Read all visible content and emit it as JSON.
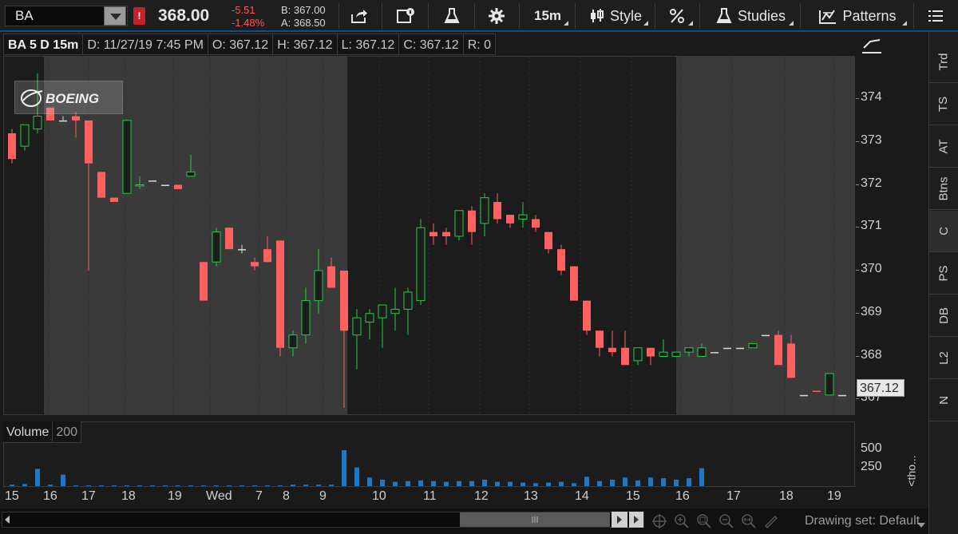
{
  "toolbar": {
    "symbol": "BA",
    "alert_badge": "!",
    "last_price": "368.00",
    "net_change": "-5.51",
    "percent_change": "-1.48%",
    "bid": "B: 367.00",
    "ask": "A: 368.50",
    "interval_label": "15m",
    "style_label": "Style",
    "studies_label": "Studies",
    "patterns_label": "Patterns"
  },
  "chart_header": {
    "title": "BA 5 D 15m",
    "date": "D: 11/27/19 7:45 PM",
    "open": "O: 367.12",
    "high": "H: 367.12",
    "low": "L: 367.12",
    "close": "C: 367.12",
    "range": "R: 0"
  },
  "volume_header": {
    "label": "Volume",
    "value": "200"
  },
  "price_axis_labels": [
    "374",
    "373",
    "372",
    "371",
    "370",
    "369",
    "368",
    "367"
  ],
  "current_price_tag": "367.12",
  "volume_axis_labels": [
    "500",
    "250"
  ],
  "volume_axis_unit": "<tho...",
  "time_axis_labels": [
    "15",
    "16",
    "17",
    "18",
    "19",
    "Wed",
    "7",
    "8",
    "9",
    "10",
    "11",
    "12",
    "13",
    "14",
    "15",
    "16",
    "17",
    "18",
    "19"
  ],
  "sidebar_tabs": [
    "Trd",
    "TS",
    "AT",
    "Btns",
    "C",
    "PS",
    "DB",
    "L2",
    "N"
  ],
  "sidebar_active": "C",
  "drawing_set_label": "Drawing set: Default",
  "logo_text": "BOEING",
  "colors": {
    "up": "#22cc44",
    "down": "#ff6060",
    "volume": "#1e78c8",
    "accent": "#0a4f86"
  },
  "chart_data": {
    "type": "candlestick",
    "symbol": "BA",
    "aggregation": "15m",
    "span": "5 D",
    "ylim": [
      366.8,
      374.8
    ],
    "candles": [
      {
        "o": 372.6,
        "h": 373.3,
        "l": 372.5,
        "c": 373.2,
        "dir": "down"
      },
      {
        "o": 372.9,
        "h": 373.4,
        "l": 372.8,
        "c": 373.4,
        "dir": "up"
      },
      {
        "o": 373.3,
        "h": 374.6,
        "l": 373.2,
        "c": 373.6,
        "dir": "up"
      },
      {
        "o": 373.8,
        "h": 373.8,
        "l": 373.5,
        "c": 373.5,
        "dir": "down"
      },
      {
        "o": 373.5,
        "h": 373.6,
        "l": 373.5,
        "c": 373.5,
        "dir": "flat"
      },
      {
        "o": 373.6,
        "h": 373.7,
        "l": 373.1,
        "c": 373.5,
        "dir": "down"
      },
      {
        "o": 373.5,
        "h": 373.5,
        "l": 370.0,
        "c": 372.5,
        "dir": "down"
      },
      {
        "o": 372.3,
        "h": 372.3,
        "l": 371.7,
        "c": 371.7,
        "dir": "down"
      },
      {
        "o": 371.7,
        "h": 371.7,
        "l": 371.6,
        "c": 371.6,
        "dir": "down"
      },
      {
        "o": 371.8,
        "h": 373.5,
        "l": 371.8,
        "c": 373.5,
        "dir": "up"
      },
      {
        "o": 372.0,
        "h": 372.2,
        "l": 371.9,
        "c": 372.0,
        "dir": "up"
      },
      {
        "o": 372.1,
        "h": 372.1,
        "l": 372.1,
        "c": 372.1,
        "dir": "flat"
      },
      {
        "o": 372.0,
        "h": 372.0,
        "l": 372.0,
        "c": 372.0,
        "dir": "flat"
      },
      {
        "o": 372.0,
        "h": 372.0,
        "l": 371.9,
        "c": 371.9,
        "dir": "down"
      },
      {
        "o": 372.2,
        "h": 372.7,
        "l": 372.2,
        "c": 372.3,
        "dir": "up"
      },
      {
        "o": 370.2,
        "h": 370.2,
        "l": 369.3,
        "c": 369.3,
        "dir": "down"
      },
      {
        "o": 370.2,
        "h": 371.0,
        "l": 370.1,
        "c": 370.9,
        "dir": "up"
      },
      {
        "o": 371.0,
        "h": 371.0,
        "l": 370.5,
        "c": 370.5,
        "dir": "down"
      },
      {
        "o": 370.5,
        "h": 370.6,
        "l": 370.4,
        "c": 370.5,
        "dir": "flat"
      },
      {
        "o": 370.2,
        "h": 370.3,
        "l": 370.0,
        "c": 370.1,
        "dir": "down"
      },
      {
        "o": 370.5,
        "h": 370.8,
        "l": 370.2,
        "c": 370.2,
        "dir": "down"
      },
      {
        "o": 370.7,
        "h": 370.7,
        "l": 368.0,
        "c": 368.2,
        "dir": "down"
      },
      {
        "o": 368.2,
        "h": 368.6,
        "l": 368.0,
        "c": 368.5,
        "dir": "up"
      },
      {
        "o": 368.5,
        "h": 369.6,
        "l": 368.3,
        "c": 369.3,
        "dir": "up"
      },
      {
        "o": 369.3,
        "h": 370.5,
        "l": 369.0,
        "c": 370.0,
        "dir": "up"
      },
      {
        "o": 370.1,
        "h": 370.3,
        "l": 369.6,
        "c": 369.6,
        "dir": "down"
      },
      {
        "o": 370.0,
        "h": 370.0,
        "l": 366.8,
        "c": 368.6,
        "dir": "down"
      },
      {
        "o": 368.5,
        "h": 369.1,
        "l": 367.7,
        "c": 368.9,
        "dir": "up"
      },
      {
        "o": 368.8,
        "h": 369.1,
        "l": 368.4,
        "c": 369.0,
        "dir": "up"
      },
      {
        "o": 368.9,
        "h": 369.2,
        "l": 368.2,
        "c": 369.2,
        "dir": "up"
      },
      {
        "o": 369.0,
        "h": 369.6,
        "l": 368.6,
        "c": 369.1,
        "dir": "up"
      },
      {
        "o": 369.1,
        "h": 369.6,
        "l": 368.5,
        "c": 369.5,
        "dir": "up"
      },
      {
        "o": 369.3,
        "h": 371.2,
        "l": 369.2,
        "c": 371.0,
        "dir": "up"
      },
      {
        "o": 370.9,
        "h": 371.1,
        "l": 370.6,
        "c": 370.8,
        "dir": "down"
      },
      {
        "o": 370.9,
        "h": 371.0,
        "l": 370.6,
        "c": 370.8,
        "dir": "down"
      },
      {
        "o": 370.8,
        "h": 371.4,
        "l": 370.7,
        "c": 371.4,
        "dir": "up"
      },
      {
        "o": 371.4,
        "h": 371.5,
        "l": 370.6,
        "c": 370.9,
        "dir": "down"
      },
      {
        "o": 371.1,
        "h": 371.8,
        "l": 370.8,
        "c": 371.7,
        "dir": "up"
      },
      {
        "o": 371.6,
        "h": 371.8,
        "l": 371.1,
        "c": 371.2,
        "dir": "down"
      },
      {
        "o": 371.3,
        "h": 371.3,
        "l": 371.0,
        "c": 371.1,
        "dir": "down"
      },
      {
        "o": 371.2,
        "h": 371.6,
        "l": 371.0,
        "c": 371.3,
        "dir": "up"
      },
      {
        "o": 371.2,
        "h": 371.3,
        "l": 370.9,
        "c": 371.0,
        "dir": "down"
      },
      {
        "o": 370.9,
        "h": 370.9,
        "l": 370.4,
        "c": 370.5,
        "dir": "down"
      },
      {
        "o": 370.5,
        "h": 370.6,
        "l": 369.9,
        "c": 370.0,
        "dir": "down"
      },
      {
        "o": 370.1,
        "h": 370.1,
        "l": 369.3,
        "c": 369.3,
        "dir": "down"
      },
      {
        "o": 369.3,
        "h": 369.3,
        "l": 368.5,
        "c": 368.6,
        "dir": "down"
      },
      {
        "o": 368.6,
        "h": 368.6,
        "l": 368.0,
        "c": 368.2,
        "dir": "down"
      },
      {
        "o": 368.2,
        "h": 368.6,
        "l": 368.0,
        "c": 368.1,
        "dir": "down"
      },
      {
        "o": 368.2,
        "h": 368.6,
        "l": 367.8,
        "c": 367.8,
        "dir": "down"
      },
      {
        "o": 367.9,
        "h": 368.2,
        "l": 367.8,
        "c": 368.2,
        "dir": "up"
      },
      {
        "o": 368.2,
        "h": 368.2,
        "l": 367.8,
        "c": 368.0,
        "dir": "down"
      },
      {
        "o": 368.0,
        "h": 368.4,
        "l": 368.0,
        "c": 368.1,
        "dir": "up"
      },
      {
        "o": 368.0,
        "h": 368.1,
        "l": 368.0,
        "c": 368.1,
        "dir": "up"
      },
      {
        "o": 368.1,
        "h": 368.2,
        "l": 368.0,
        "c": 368.2,
        "dir": "up"
      },
      {
        "o": 368.0,
        "h": 368.3,
        "l": 368.0,
        "c": 368.2,
        "dir": "up"
      },
      {
        "o": 368.1,
        "h": 368.1,
        "l": 368.1,
        "c": 368.1,
        "dir": "flat"
      },
      {
        "o": 368.2,
        "h": 368.2,
        "l": 368.2,
        "c": 368.2,
        "dir": "flat"
      },
      {
        "o": 368.2,
        "h": 368.2,
        "l": 368.2,
        "c": 368.2,
        "dir": "flat"
      },
      {
        "o": 368.3,
        "h": 368.3,
        "l": 368.2,
        "c": 368.2,
        "dir": "up"
      },
      {
        "o": 368.5,
        "h": 368.5,
        "l": 368.5,
        "c": 368.5,
        "dir": "flat"
      },
      {
        "o": 368.5,
        "h": 368.6,
        "l": 367.8,
        "c": 367.8,
        "dir": "down"
      },
      {
        "o": 368.3,
        "h": 368.5,
        "l": 367.5,
        "c": 367.5,
        "dir": "down"
      },
      {
        "o": 367.1,
        "h": 367.1,
        "l": 367.1,
        "c": 367.1,
        "dir": "flat"
      },
      {
        "o": 367.2,
        "h": 367.2,
        "l": 367.2,
        "c": 367.2,
        "dir": "down"
      },
      {
        "o": 367.1,
        "h": 367.6,
        "l": 367.1,
        "c": 367.6,
        "dir": "up"
      },
      {
        "o": 367.1,
        "h": 367.1,
        "l": 367.1,
        "c": 367.1,
        "dir": "flat"
      }
    ],
    "volume": [
      20,
      30,
      240,
      20,
      160,
      10,
      10,
      10,
      10,
      10,
      10,
      10,
      10,
      10,
      10,
      10,
      10,
      10,
      10,
      10,
      10,
      10,
      20,
      20,
      20,
      20,
      500,
      260,
      120,
      90,
      60,
      70,
      80,
      70,
      60,
      70,
      70,
      90,
      60,
      60,
      50,
      40,
      50,
      60,
      40,
      130,
      70,
      90,
      120,
      80,
      120,
      110,
      90,
      110,
      250
    ],
    "volume_ylim": [
      0,
      600
    ]
  }
}
